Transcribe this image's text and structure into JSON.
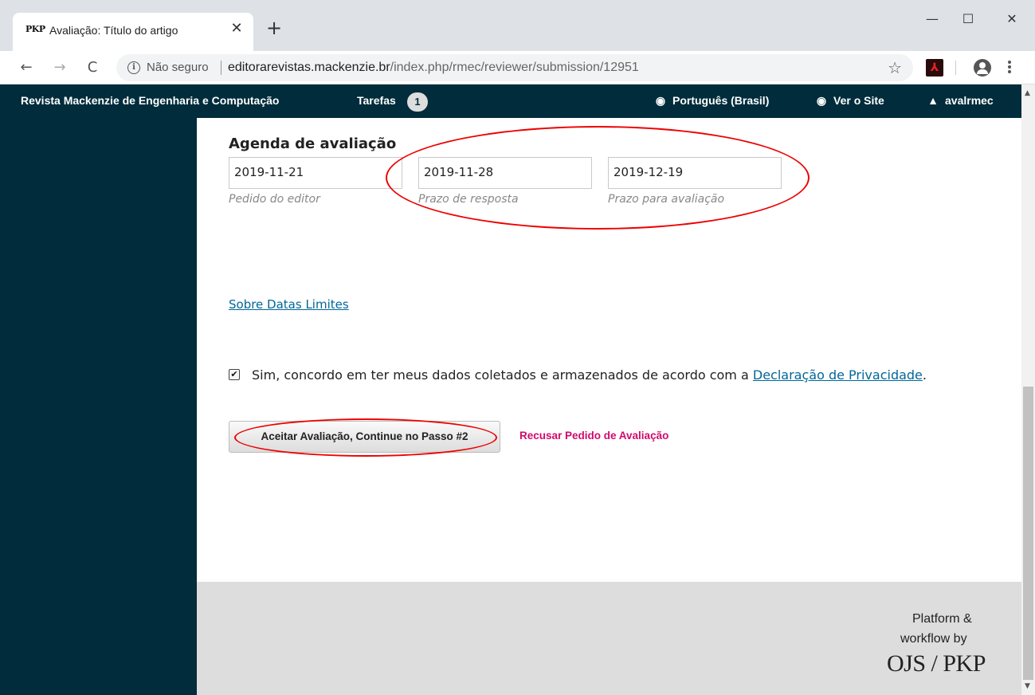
{
  "browser": {
    "tab": {
      "favicon": "PKP",
      "title": "Avaliação: Título do artigo",
      "close": "✕"
    },
    "new_tab": "+",
    "window": {
      "minimize": "—",
      "maximize": "☐",
      "close": "✕"
    },
    "nav": {
      "back": "←",
      "forward": "→",
      "reload": "C"
    },
    "address": {
      "security_icon": "i",
      "security_label": "Não seguro",
      "host": "editorarevistas.mackenzie.br",
      "path": "/index.php/rmec/reviewer/submission/12951",
      "bookmark": "☆"
    },
    "icons": [
      "info-icon",
      "star-icon",
      "pdf-extension-icon",
      "account-icon",
      "menu-icon"
    ]
  },
  "header": {
    "journal": "Revista Mackenzie de Engenharia e Computação",
    "tasks_label": "Tarefas",
    "tasks_count": "1",
    "language": "Português (Brasil)",
    "view_site": "Ver o Site",
    "user": "avalrmec"
  },
  "schedule": {
    "title": "Agenda de avaliação",
    "fields": [
      {
        "value": "2019-11-21",
        "label": "Pedido do editor"
      },
      {
        "value": "2019-11-28",
        "label": "Prazo de resposta"
      },
      {
        "value": "2019-12-19",
        "label": "Prazo para avaliação"
      }
    ]
  },
  "deadlines_link": "Sobre Datas Limites",
  "consent": {
    "checked": true,
    "text": "Sim, concordo em ter meus dados coletados e armazenados de acordo com a ",
    "link": "Declaração de Privacidade",
    "suffix": "."
  },
  "actions": {
    "accept": "Aceitar Avaliação, Continue no Passo #2",
    "decline": "Recusar Pedido de Avaliação"
  },
  "footer": {
    "line1": "Platform &",
    "line2": "workflow by",
    "logo": "OJS / PKP"
  },
  "colors": {
    "header_bg": "#002c3c",
    "link": "#006798",
    "decline": "#d00a6c",
    "annotation": "#e00000"
  }
}
